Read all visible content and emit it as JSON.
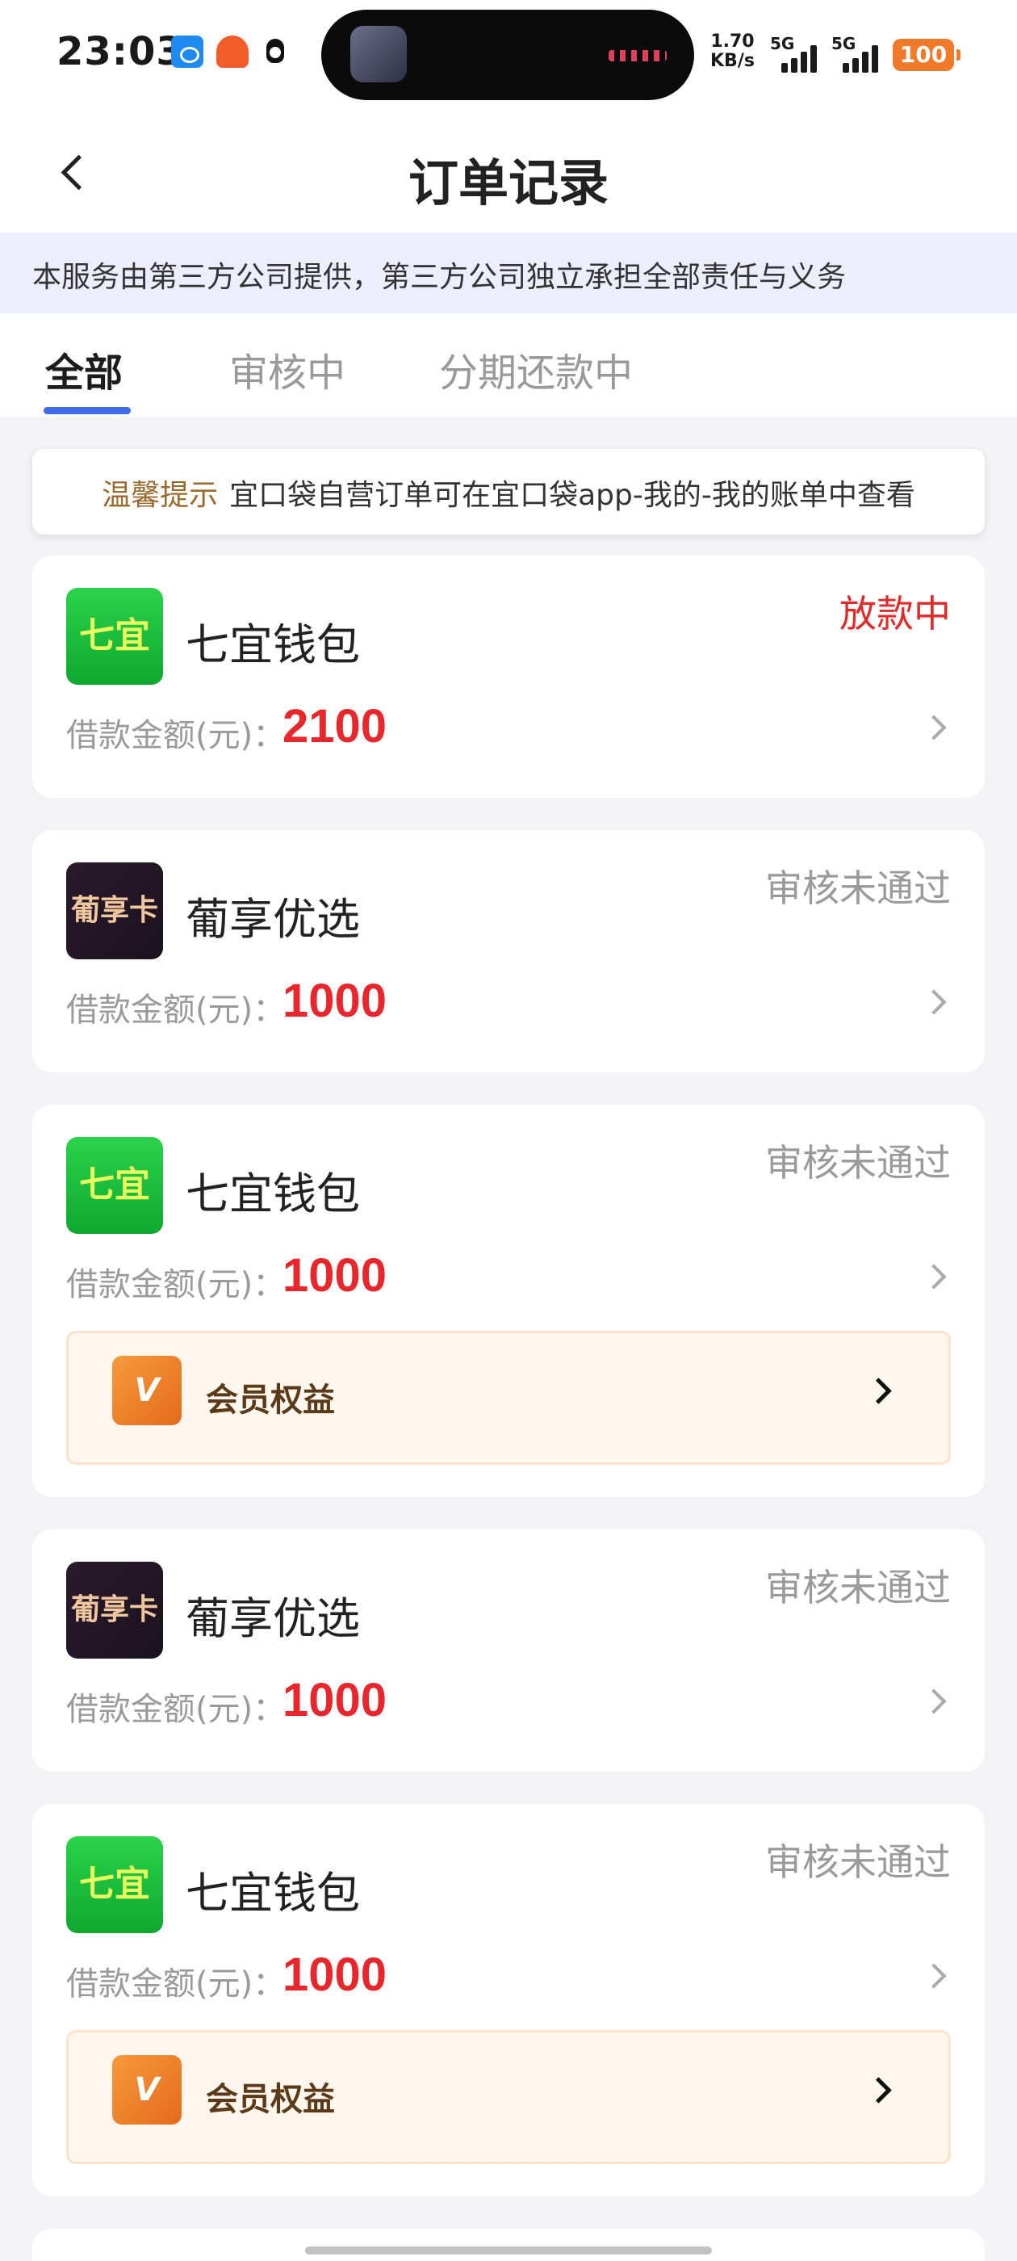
{
  "status_bar": {
    "time": "23:03",
    "speed": "1.70",
    "speed_unit": "KB/s",
    "net1": "5G",
    "net2": "5G",
    "battery": "100"
  },
  "header": {
    "title": "订单记录"
  },
  "notice": "本服务由第三方公司提供，第三方公司独立承担全部责任与义务",
  "tabs": [
    {
      "label": "全部",
      "active": true
    },
    {
      "label": "审核中",
      "active": false
    },
    {
      "label": "分期还款中",
      "active": false
    }
  ],
  "tip": {
    "label": "温馨提示",
    "text": "宜口袋自营订单可在宜口袋app-我的-我的账单中查看"
  },
  "amount_label": "借款金额(元)：",
  "orders": [
    {
      "logo_text": "七宜",
      "name": "七宜钱包",
      "status": "放款中",
      "amount": "2100"
    },
    {
      "logo_text": "葡享卡",
      "name": "葡享优选",
      "status": "审核未通过",
      "amount": "1000"
    },
    {
      "logo_text": "七宜",
      "name": "七宜钱包",
      "status": "审核未通过",
      "amount": "1000",
      "vip_label": "会员权益"
    },
    {
      "logo_text": "葡享卡",
      "name": "葡享优选",
      "status": "审核未通过",
      "amount": "1000"
    },
    {
      "logo_text": "七宜",
      "name": "七宜钱包",
      "status": "审核未通过",
      "amount": "1000",
      "vip_label": "会员权益"
    }
  ],
  "vip_icon_text": "V",
  "colors": {
    "accent_blue": "#3f6bea",
    "amount_red": "#e8262c",
    "status_gray": "#9a9a9a",
    "notice_bg": "#eceefc"
  }
}
